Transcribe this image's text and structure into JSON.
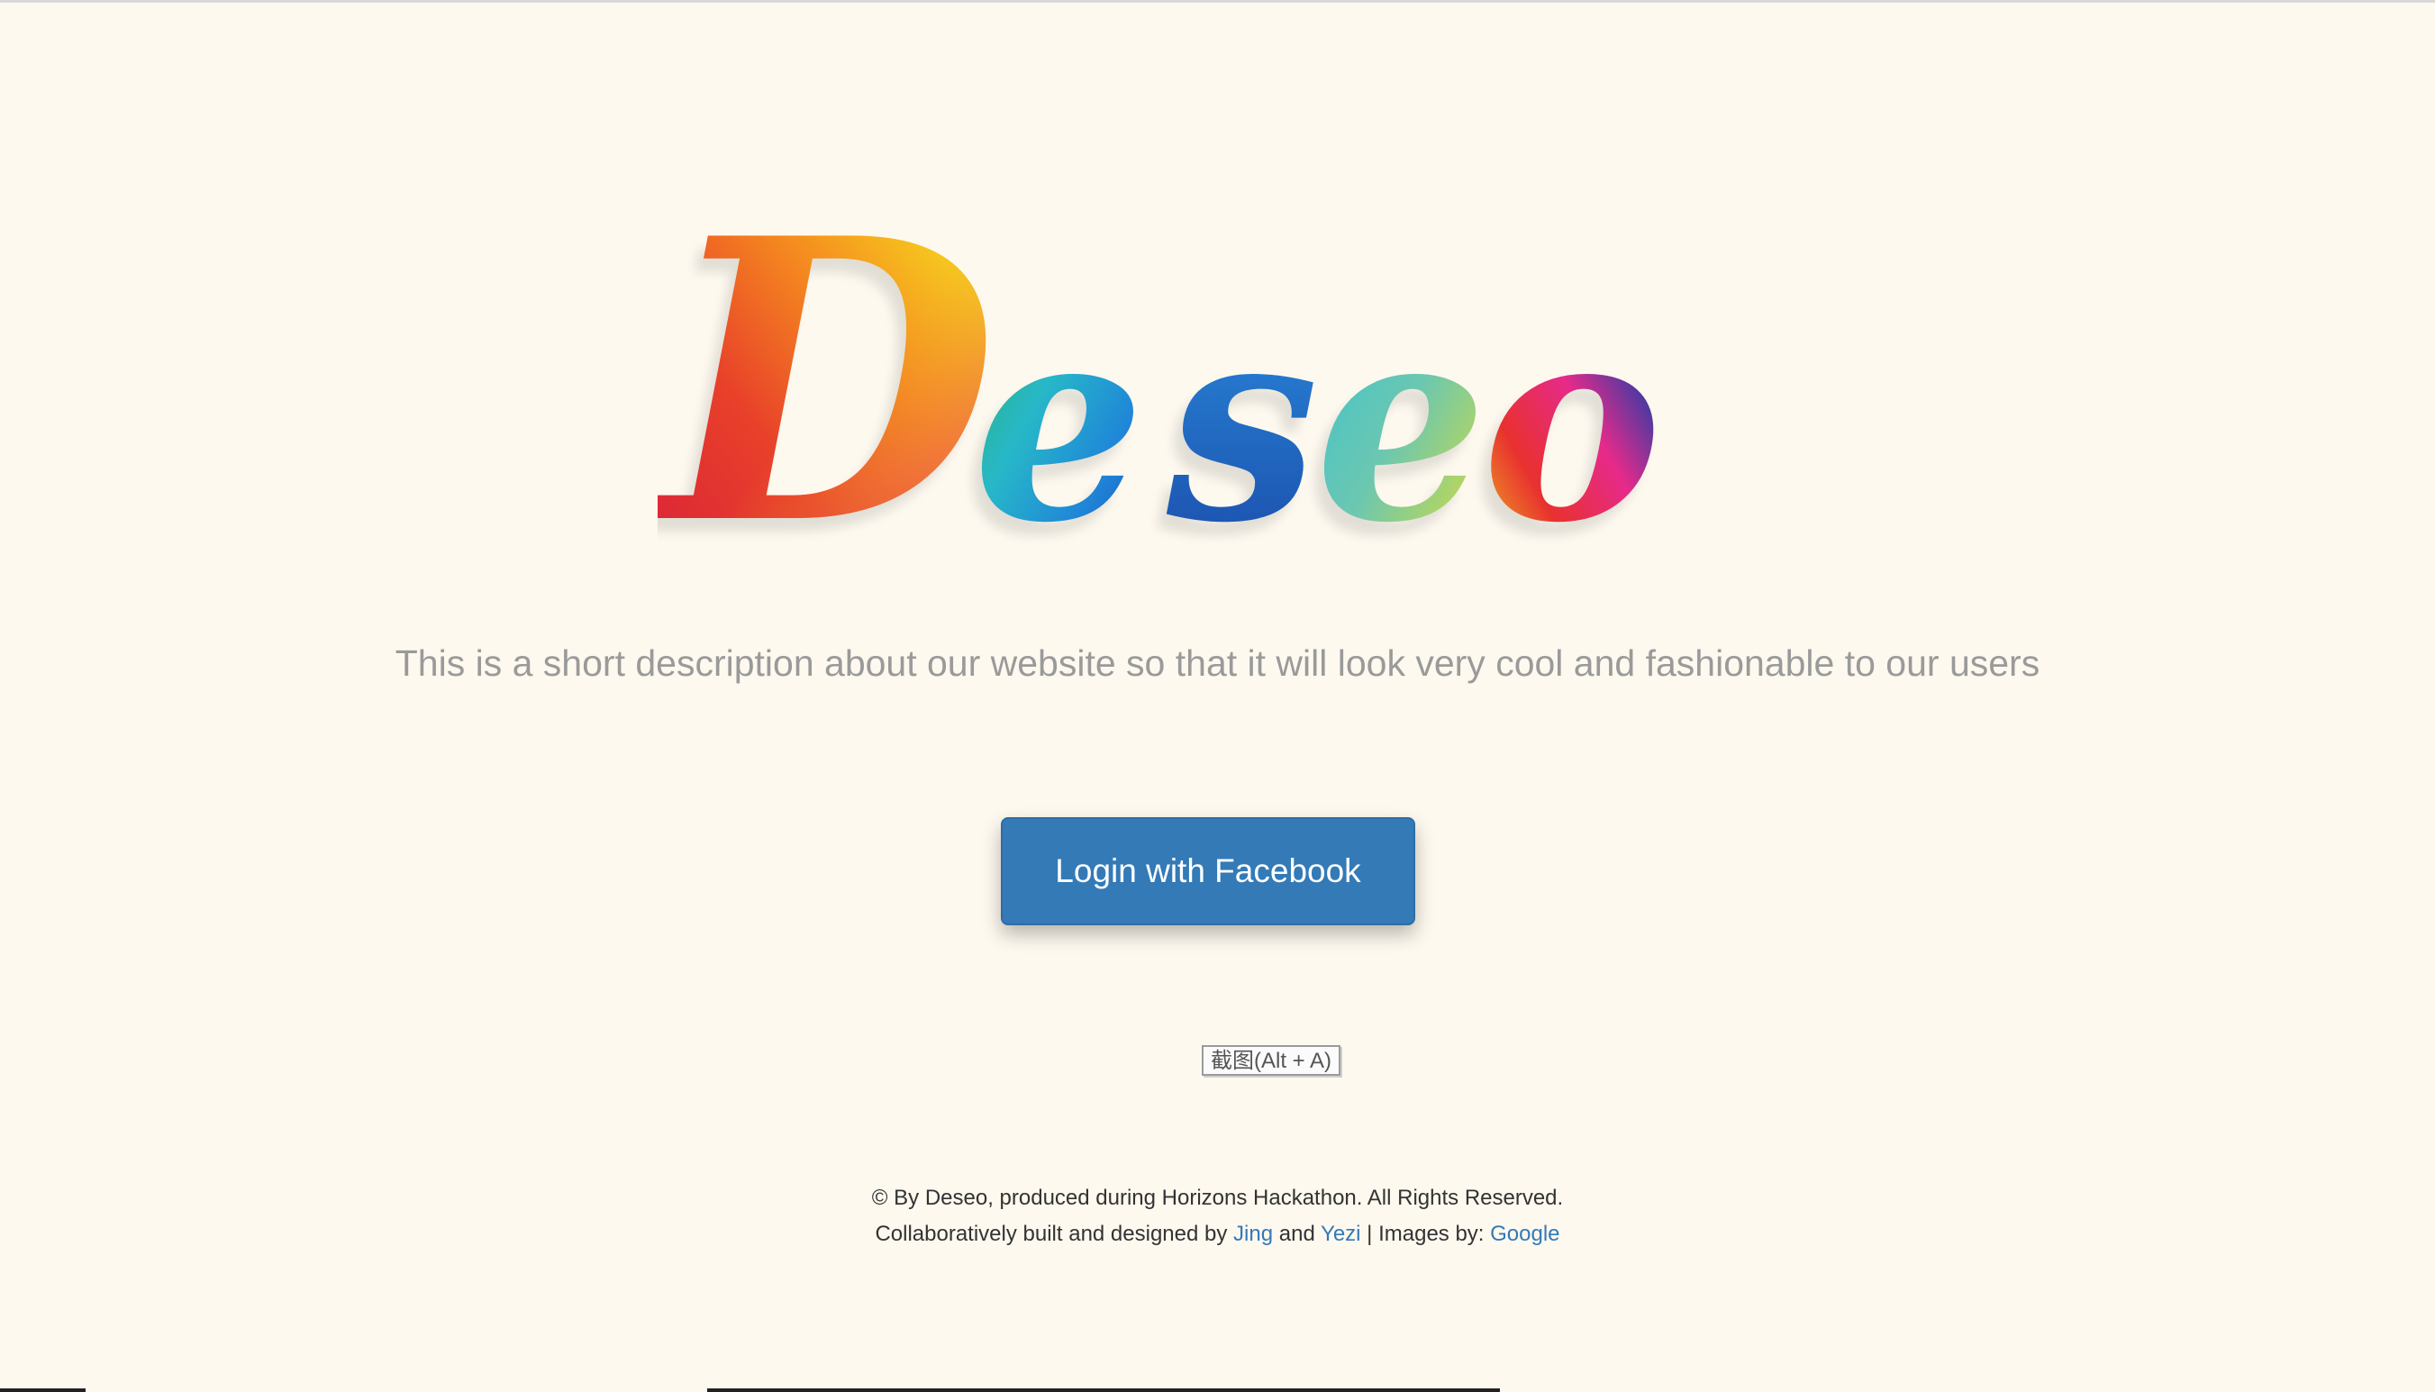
{
  "brand": {
    "logo_text": "Deseo",
    "letters": [
      "D",
      "e",
      "s",
      "e",
      "o"
    ]
  },
  "tagline": "This is a short description about our website so that it will look very cool and fashionable to our users",
  "login_button": {
    "label": "Login with Facebook"
  },
  "screenshot_tooltip": "截图(Alt + A)",
  "footer": {
    "line1": "© By Deseo, produced during Horizons Hackathon. All Rights Reserved.",
    "line2_prefix": "Collaboratively built and designed by ",
    "author1": "Jing",
    "and_text": " and ",
    "author2": "Yezi",
    "images_prefix": " | Images by: ",
    "images_source": "Google"
  },
  "colors": {
    "background": "#fef9ef",
    "primary_button": "#337ab7",
    "tagline": "#9a9a9a",
    "link": "#337ab7"
  }
}
